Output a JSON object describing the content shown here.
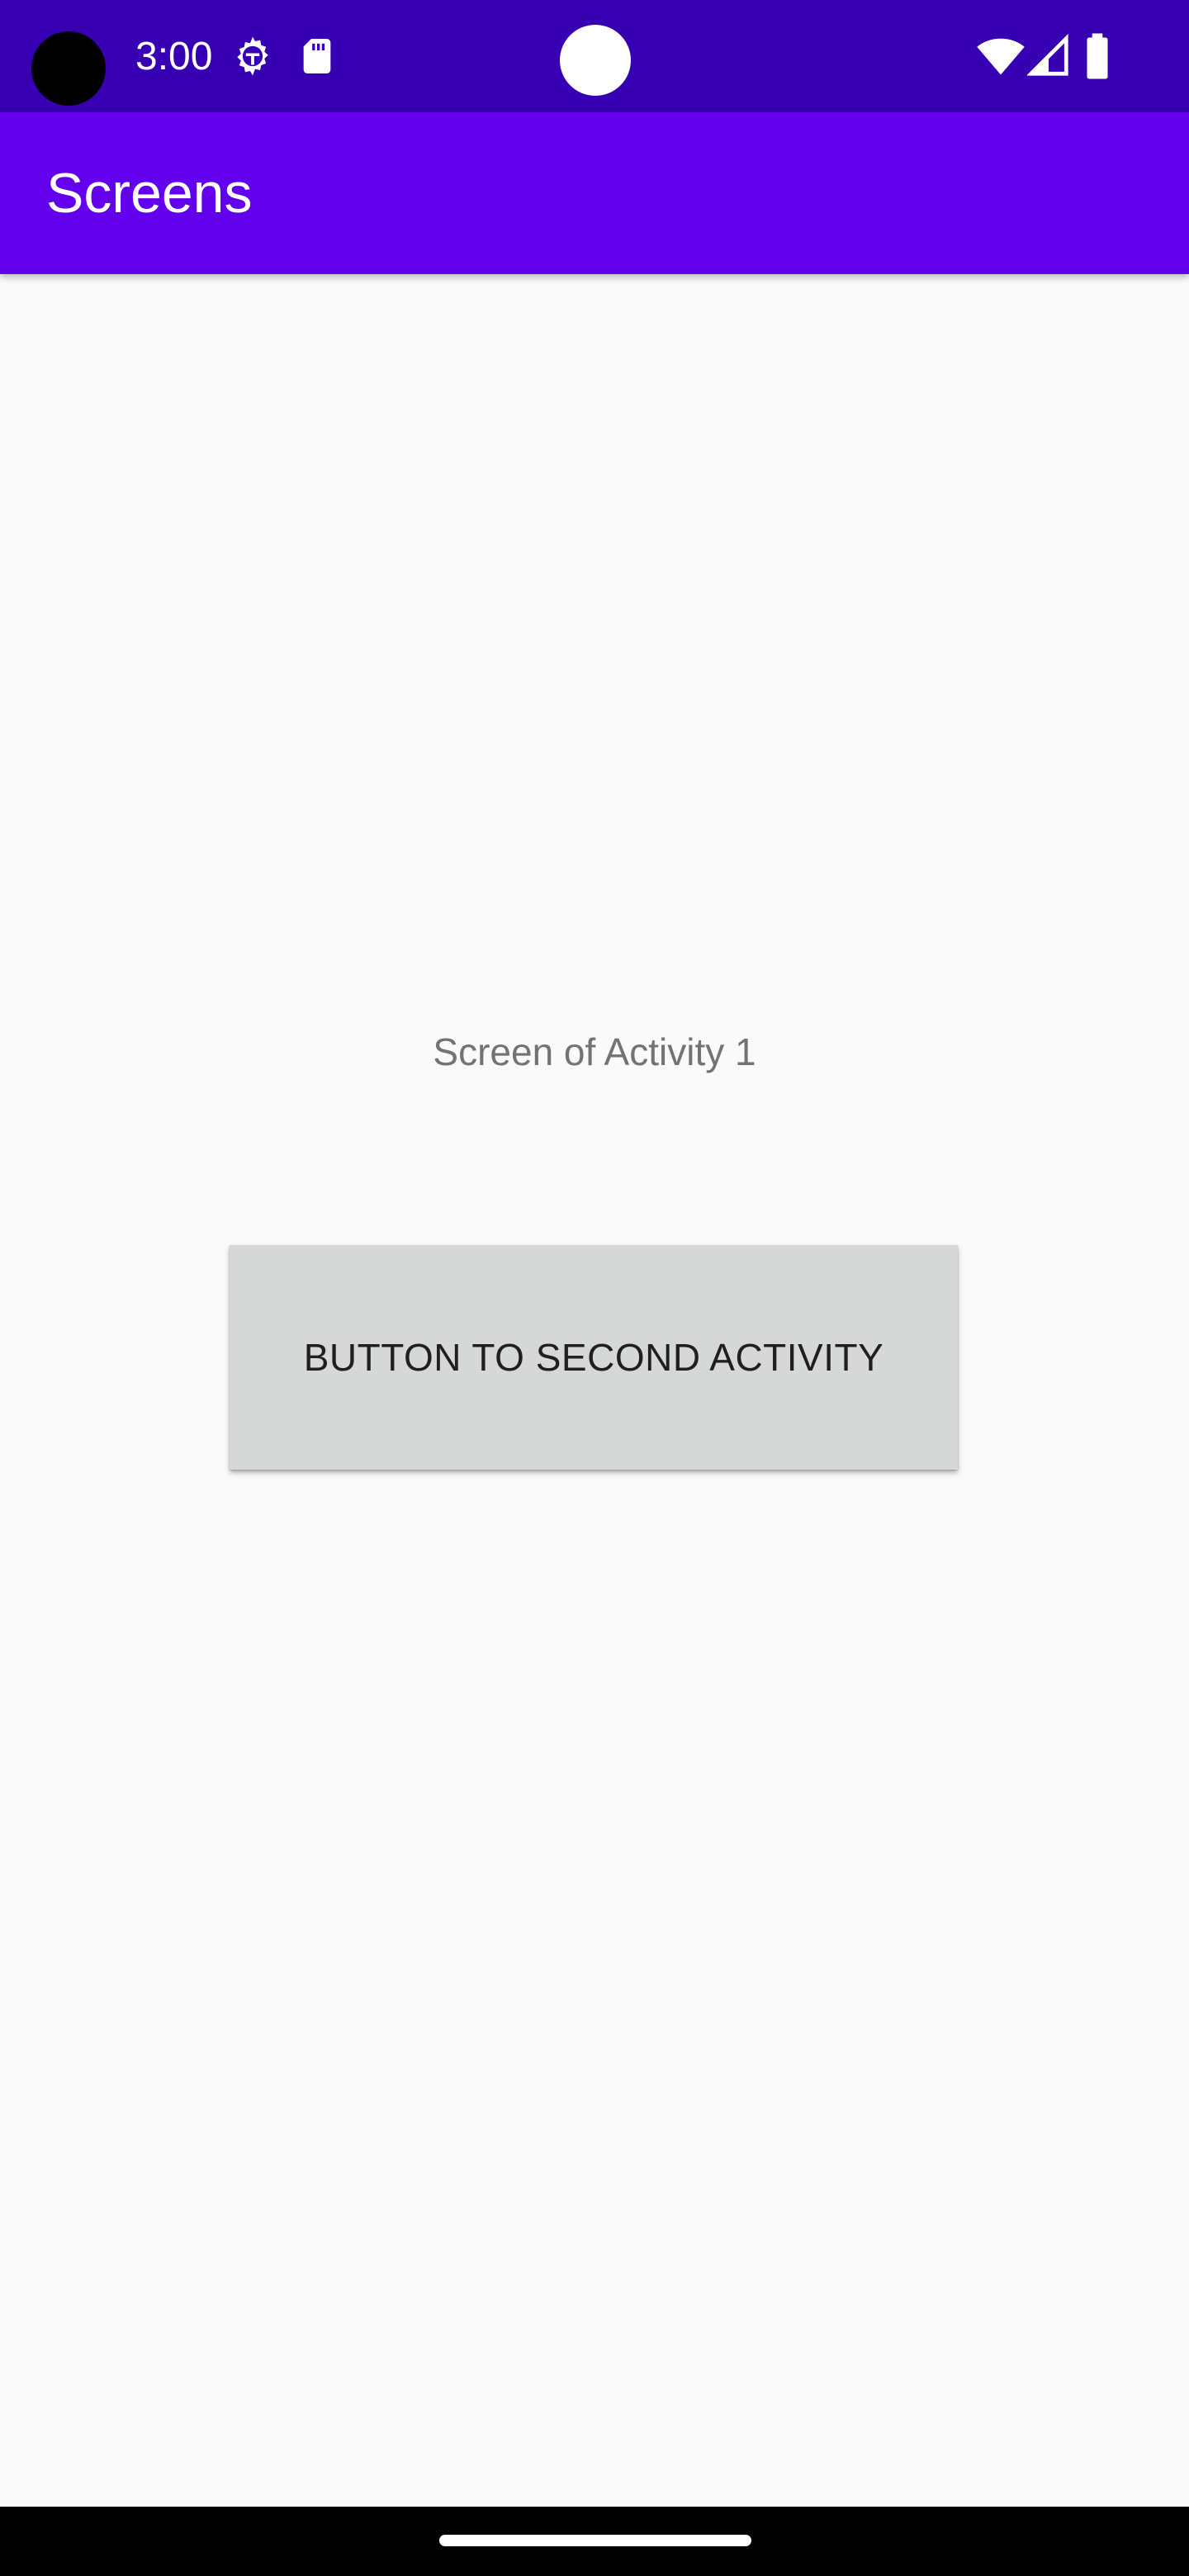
{
  "status_bar": {
    "time": "3:00",
    "icons": [
      "camera-cutout",
      "gear-icon",
      "sdcard-icon",
      "center-dot",
      "wifi-icon",
      "signal-icon",
      "battery-icon"
    ],
    "background_color": "#3700b3"
  },
  "app_bar": {
    "title": "Screens",
    "background_color": "#6200ee"
  },
  "main": {
    "label": "Screen of Activity 1",
    "button_label": "BUTTON TO SECOND ACTIVITY",
    "button_color": "#d6d7d7"
  },
  "nav_bar": {
    "icons": [
      "home-handle"
    ]
  }
}
